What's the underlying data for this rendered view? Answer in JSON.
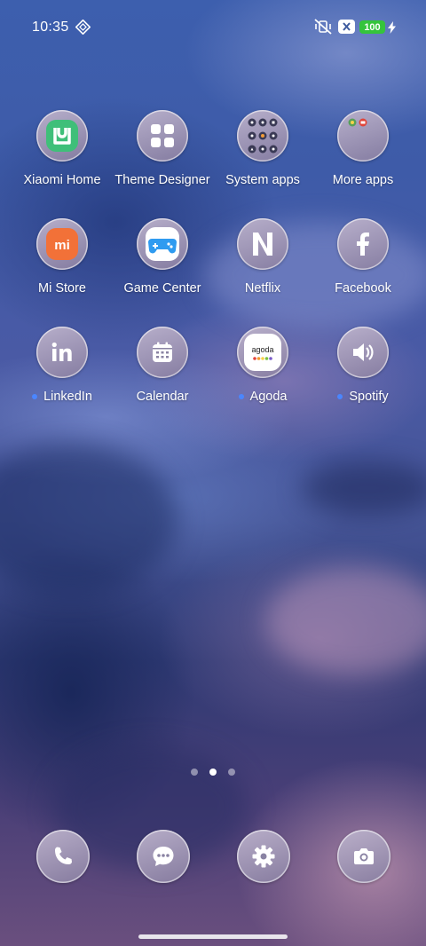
{
  "status_bar": {
    "time": "10:35",
    "battery_level": "100",
    "icons": [
      "ai-diamond-icon",
      "vibrate-mute-icon",
      "sim-x-icon",
      "charging-bolt-icon"
    ]
  },
  "apps": [
    {
      "label": "Xiaomi Home",
      "icon": "xiaomi-home-icon",
      "dot": false
    },
    {
      "label": "Theme Designer",
      "icon": "theme-designer-icon",
      "dot": false
    },
    {
      "label": "System apps",
      "icon": "folder-icon",
      "dot": false
    },
    {
      "label": "More apps",
      "icon": "folder-icon",
      "dot": false
    },
    {
      "label": "Mi Store",
      "icon": "mi-store-icon",
      "dot": false
    },
    {
      "label": "Game Center",
      "icon": "game-center-icon",
      "dot": false
    },
    {
      "label": "Netflix",
      "icon": "netflix-icon",
      "dot": false
    },
    {
      "label": "Facebook",
      "icon": "facebook-icon",
      "dot": false
    },
    {
      "label": "LinkedIn",
      "icon": "linkedin-icon",
      "dot": true
    },
    {
      "label": "Calendar",
      "icon": "calendar-icon",
      "dot": false
    },
    {
      "label": "Agoda",
      "icon": "agoda-icon",
      "dot": true
    },
    {
      "label": "Spotify",
      "icon": "spotify-icon",
      "dot": true
    }
  ],
  "agoda_logo_text": "agoda",
  "mi_logo_text": "mi",
  "page_indicator": {
    "count": 3,
    "active": 2
  },
  "dock": [
    {
      "icon": "phone-icon"
    },
    {
      "icon": "messages-icon"
    },
    {
      "icon": "settings-icon"
    },
    {
      "icon": "camera-icon"
    }
  ],
  "colors": {
    "new_app_dot": "#4a86ff",
    "battery": "#35c43c",
    "mi_store": "#f27138",
    "xiaomi_home": "#3fbf79"
  }
}
